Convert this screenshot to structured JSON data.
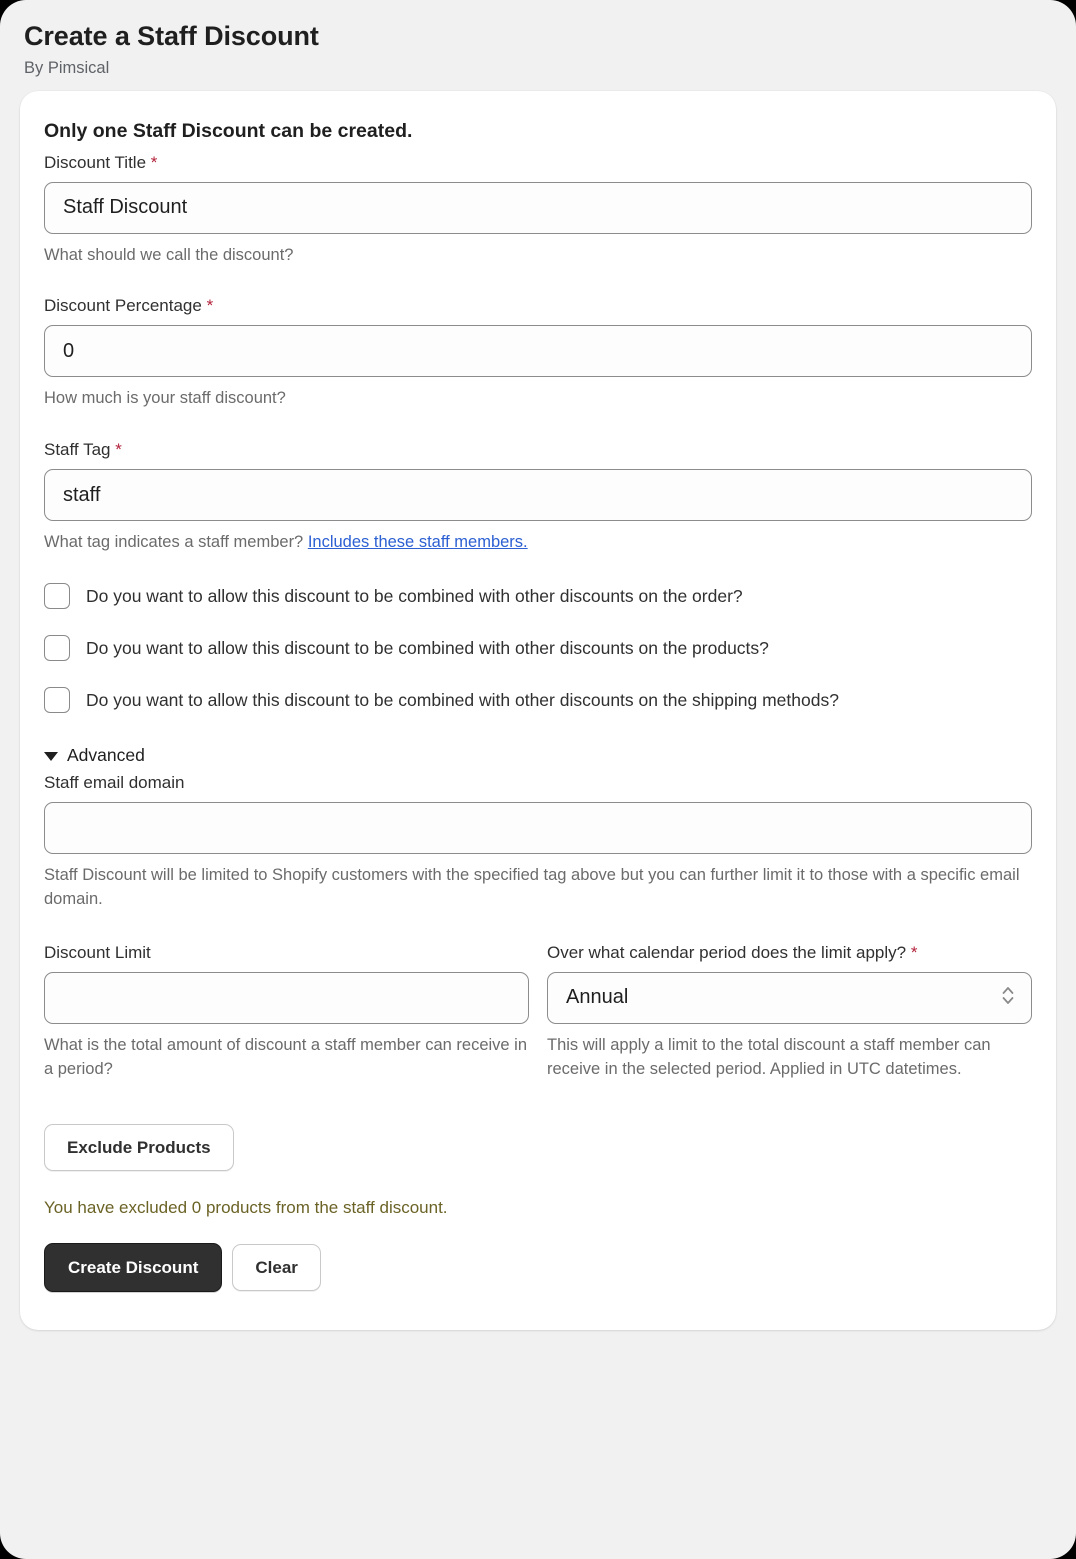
{
  "header": {
    "title": "Create a Staff Discount",
    "subtitle": "By Pimsical"
  },
  "card": {
    "heading": "Only one Staff Discount can be created.",
    "required_marker": "*",
    "fields": {
      "discount_title": {
        "label": "Discount Title",
        "value": "Staff Discount",
        "placeholder": "",
        "help": "What should we call the discount?"
      },
      "discount_percentage": {
        "label": "Discount Percentage",
        "value": "0",
        "placeholder": "",
        "help": "How much is your staff discount?"
      },
      "staff_tag": {
        "label": "Staff Tag",
        "value": "staff",
        "placeholder": "",
        "help_prefix": "What tag indicates a staff member? ",
        "help_link": "Includes these staff members."
      },
      "staff_email_domain": {
        "label": "Staff email domain",
        "value": "",
        "placeholder": "",
        "help": "Staff Discount will be limited to Shopify customers with the specified tag above but you can further limit it to those with a specific email domain."
      },
      "discount_limit": {
        "label": "Discount Limit",
        "value": "",
        "placeholder": "",
        "help": "What is the total amount of discount a staff member can receive in a period?"
      },
      "calendar_period": {
        "label": "Over what calendar period does the limit apply?",
        "value": "Annual",
        "options": [
          "Annual"
        ],
        "help": "This will apply a limit to the total discount a staff member can receive in the selected period. Applied in UTC datetimes."
      }
    },
    "checkboxes": [
      {
        "label": "Do you want to allow this discount to be combined with other discounts on the order?",
        "checked": false
      },
      {
        "label": "Do you want to allow this discount to be combined with other discounts on the products?",
        "checked": false
      },
      {
        "label": "Do you want to allow this discount to be combined with other discounts on the shipping methods?",
        "checked": false
      }
    ],
    "advanced": {
      "label": "Advanced",
      "expanded": true
    },
    "exclude_products_button": "Exclude Products",
    "excluded_note": "You have excluded 0 products from the staff discount.",
    "primary_button": "Create Discount",
    "secondary_button": "Clear"
  },
  "colors": {
    "page_background": "#f1f1f1",
    "card_background": "#ffffff",
    "required_marker": "#b3233b",
    "link": "#2c60d3",
    "note": "#6b6326",
    "primary_button": "#303030"
  }
}
